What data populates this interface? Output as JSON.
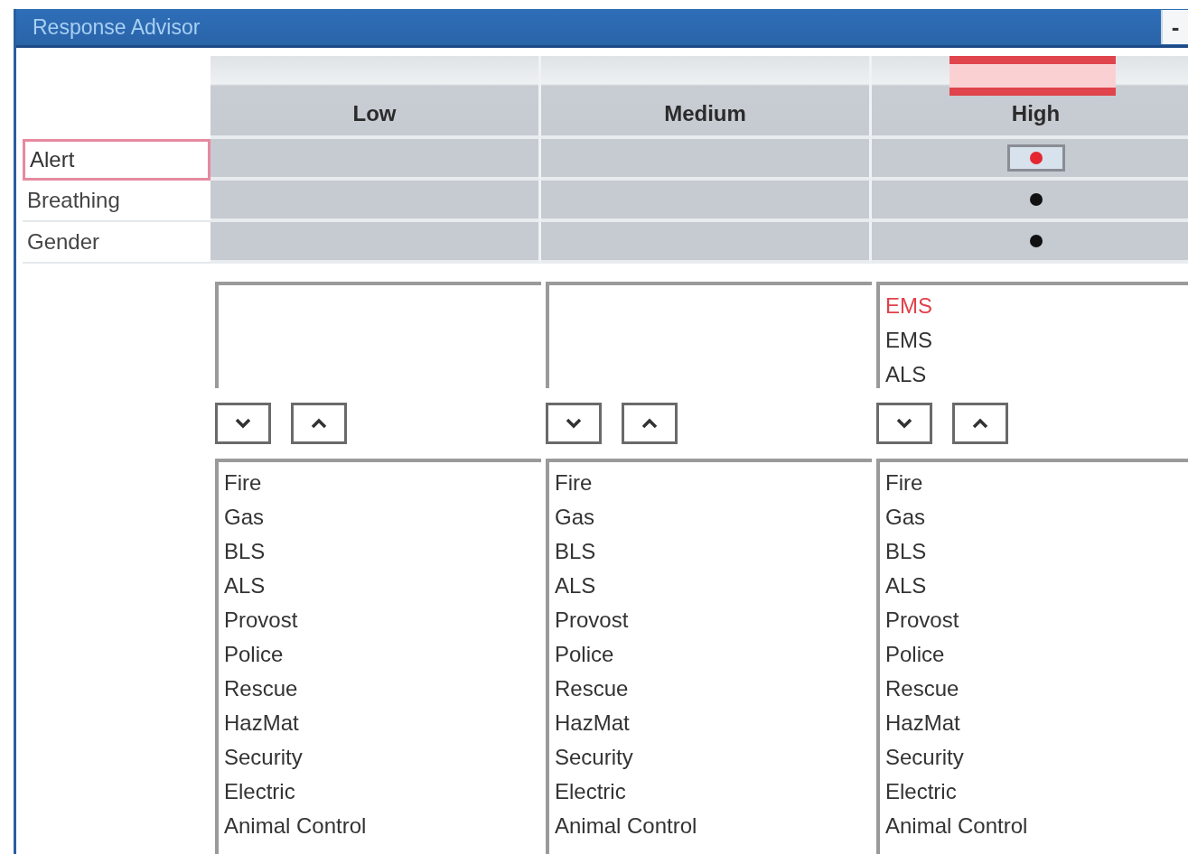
{
  "window": {
    "title": "Response Advisor",
    "minimize_label": "-"
  },
  "levels": [
    {
      "name": "Low",
      "selected": false
    },
    {
      "name": "Medium",
      "selected": false
    },
    {
      "name": "High",
      "selected": true
    }
  ],
  "criteria": [
    {
      "label": "Alert",
      "selected": true,
      "cells": [
        {
          "dot": false
        },
        {
          "dot": false
        },
        {
          "dot": true
        }
      ]
    },
    {
      "label": "Breathing",
      "selected": false,
      "cells": [
        {
          "dot": false
        },
        {
          "dot": false
        },
        {
          "dot": true
        }
      ]
    },
    {
      "label": "Gender",
      "selected": false,
      "cells": [
        {
          "dot": false
        },
        {
          "dot": false
        },
        {
          "dot": true
        }
      ]
    }
  ],
  "columns": [
    {
      "available": [
        "Fire",
        "Gas",
        "BLS",
        "ALS",
        "Provost",
        "Police",
        "Rescue",
        "HazMat",
        "Security",
        "Electric",
        "Animal Control"
      ]
    },
    {
      "available": [
        "Fire",
        "Gas",
        "BLS",
        "ALS",
        "Provost",
        "Police",
        "Rescue",
        "HazMat",
        "Security",
        "Electric",
        "Animal Control"
      ]
    },
    {
      "assigned": [
        {
          "text": "EMS",
          "selected": true
        },
        {
          "text": "EMS",
          "selected": false
        },
        {
          "text": "ALS",
          "selected": false
        }
      ],
      "available": [
        "Fire",
        "Gas",
        "BLS",
        "ALS",
        "Provost",
        "Police",
        "Rescue",
        "HazMat",
        "Security",
        "Electric",
        "Animal Control"
      ]
    }
  ]
}
